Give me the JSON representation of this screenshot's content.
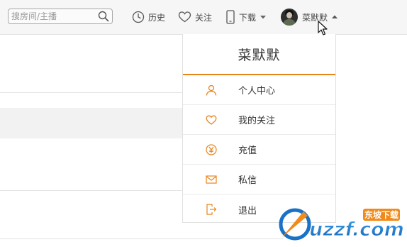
{
  "topbar": {
    "search": {
      "placeholder": "搜房间/主播",
      "value": ""
    },
    "history_label": "历史",
    "follow_label": "关注",
    "download_label": "下载",
    "username": "菜默默"
  },
  "dropdown": {
    "title": "菜默默",
    "accent_color": "#e8841c",
    "items": [
      {
        "label": "个人中心",
        "icon": "user-icon"
      },
      {
        "label": "我的关注",
        "icon": "heart-icon"
      },
      {
        "label": "充值",
        "icon": "yen-icon"
      },
      {
        "label": "私信",
        "icon": "envelope-icon"
      },
      {
        "label": "退出",
        "icon": "logout-icon"
      }
    ]
  },
  "watermark": {
    "text": "uzzf.com",
    "subtext": "东坡下载"
  }
}
